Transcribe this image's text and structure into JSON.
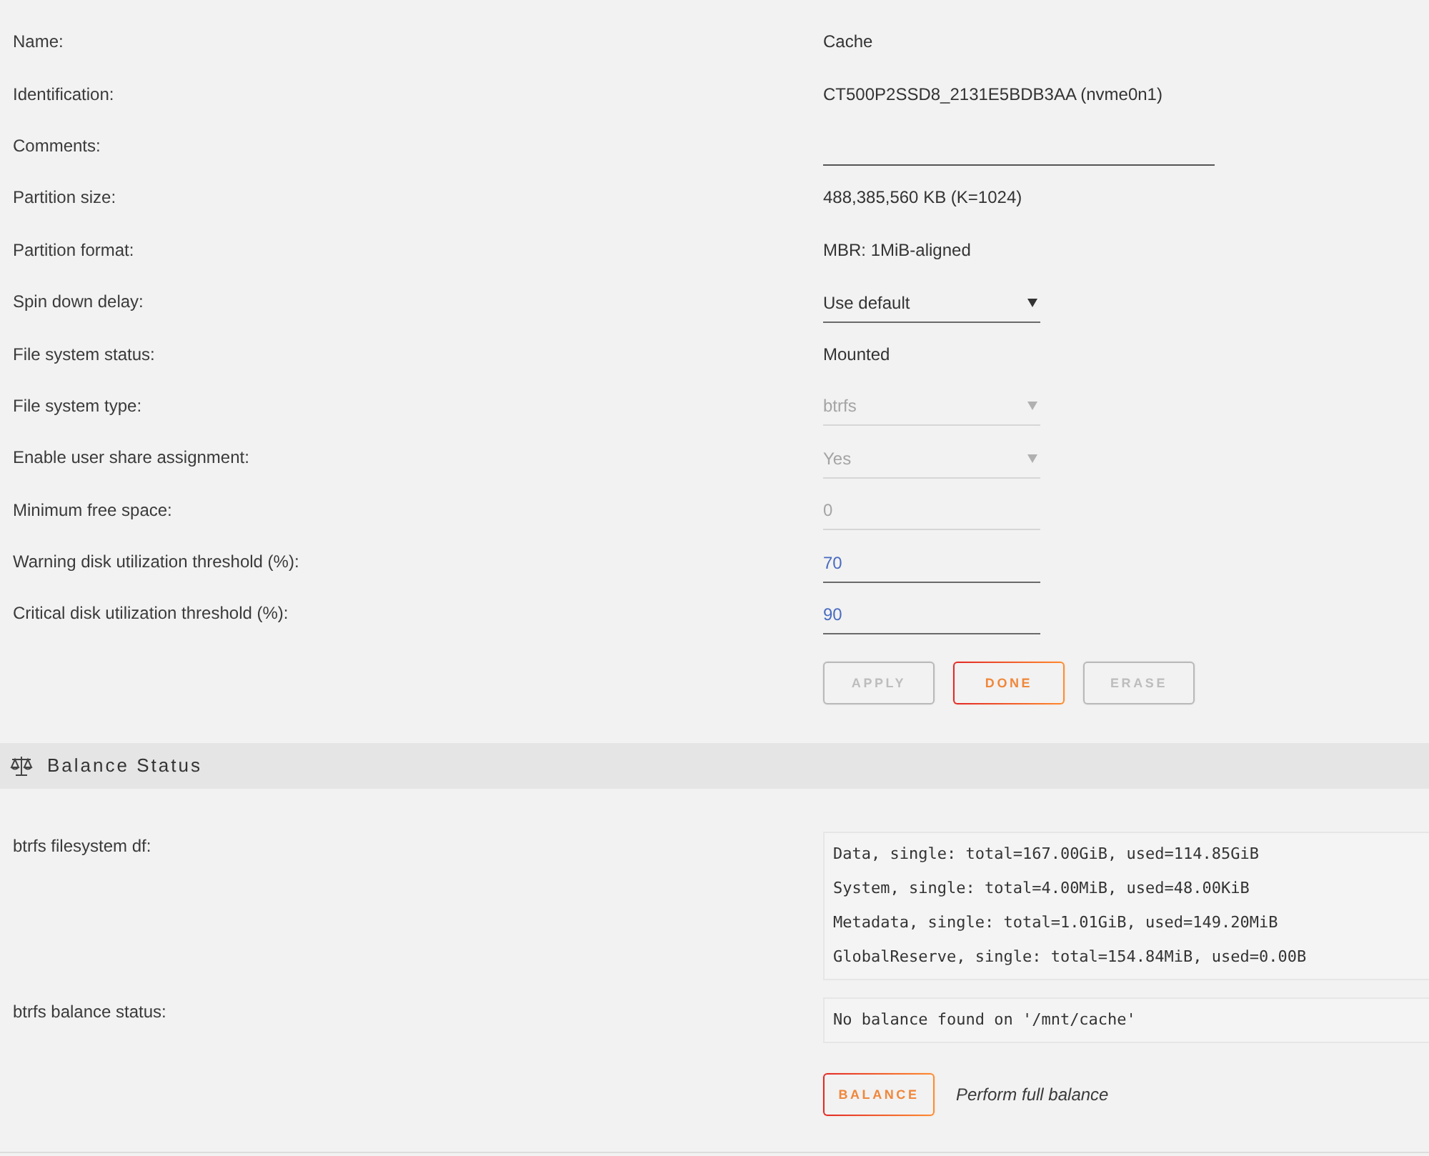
{
  "settings": [
    {
      "kind": "text",
      "label": "Name:",
      "value": "Cache"
    },
    {
      "kind": "text",
      "label": "Identification:",
      "value": "CT500P2SSD8_2131E5BDB3AA (nvme0n1)"
    },
    {
      "kind": "comment",
      "label": "Comments:",
      "disabled": false
    },
    {
      "kind": "text",
      "label": "Partition size:",
      "value": "488,385,560 KB (K=1024)"
    },
    {
      "kind": "text",
      "label": "Partition format:",
      "value": "MBR: 1MiB-aligned"
    },
    {
      "kind": "select",
      "label": "Spin down delay:",
      "value": "Use default",
      "disabled": false
    },
    {
      "kind": "text",
      "label": "File system status:",
      "value": "Mounted"
    },
    {
      "kind": "select",
      "label": "File system type:",
      "value": "btrfs",
      "disabled": true
    },
    {
      "kind": "select",
      "label": "Enable user share assignment:",
      "value": "Yes",
      "disabled": true
    },
    {
      "kind": "input",
      "label": "Minimum free space:",
      "value": "0",
      "disabled": true
    },
    {
      "kind": "input",
      "label": "Warning disk utilization threshold (%):",
      "value": "70",
      "disabled": false
    },
    {
      "kind": "input",
      "label": "Critical disk utilization threshold (%):",
      "value": "90",
      "disabled": false
    }
  ],
  "buttons": [
    {
      "label": "APPLY",
      "disabled": true
    },
    {
      "label": "DONE",
      "disabled": false
    },
    {
      "label": "ERASE",
      "disabled": true
    }
  ],
  "balance": {
    "title": "Balance Status",
    "rows": [
      {
        "label": "btrfs filesystem df:",
        "lines": [
          "Data, single: total=167.00GiB, used=114.85GiB",
          "System, single: total=4.00MiB, used=48.00KiB",
          "Metadata, single: total=1.01GiB, used=149.20MiB",
          "GlobalReserve, single: total=154.84MiB, used=0.00B"
        ]
      },
      {
        "label": "btrfs balance status:",
        "lines": [
          "No balance found on '/mnt/cache'"
        ]
      }
    ],
    "button": {
      "label": "BALANCE",
      "disabled": false
    },
    "note": "Perform full balance"
  }
}
